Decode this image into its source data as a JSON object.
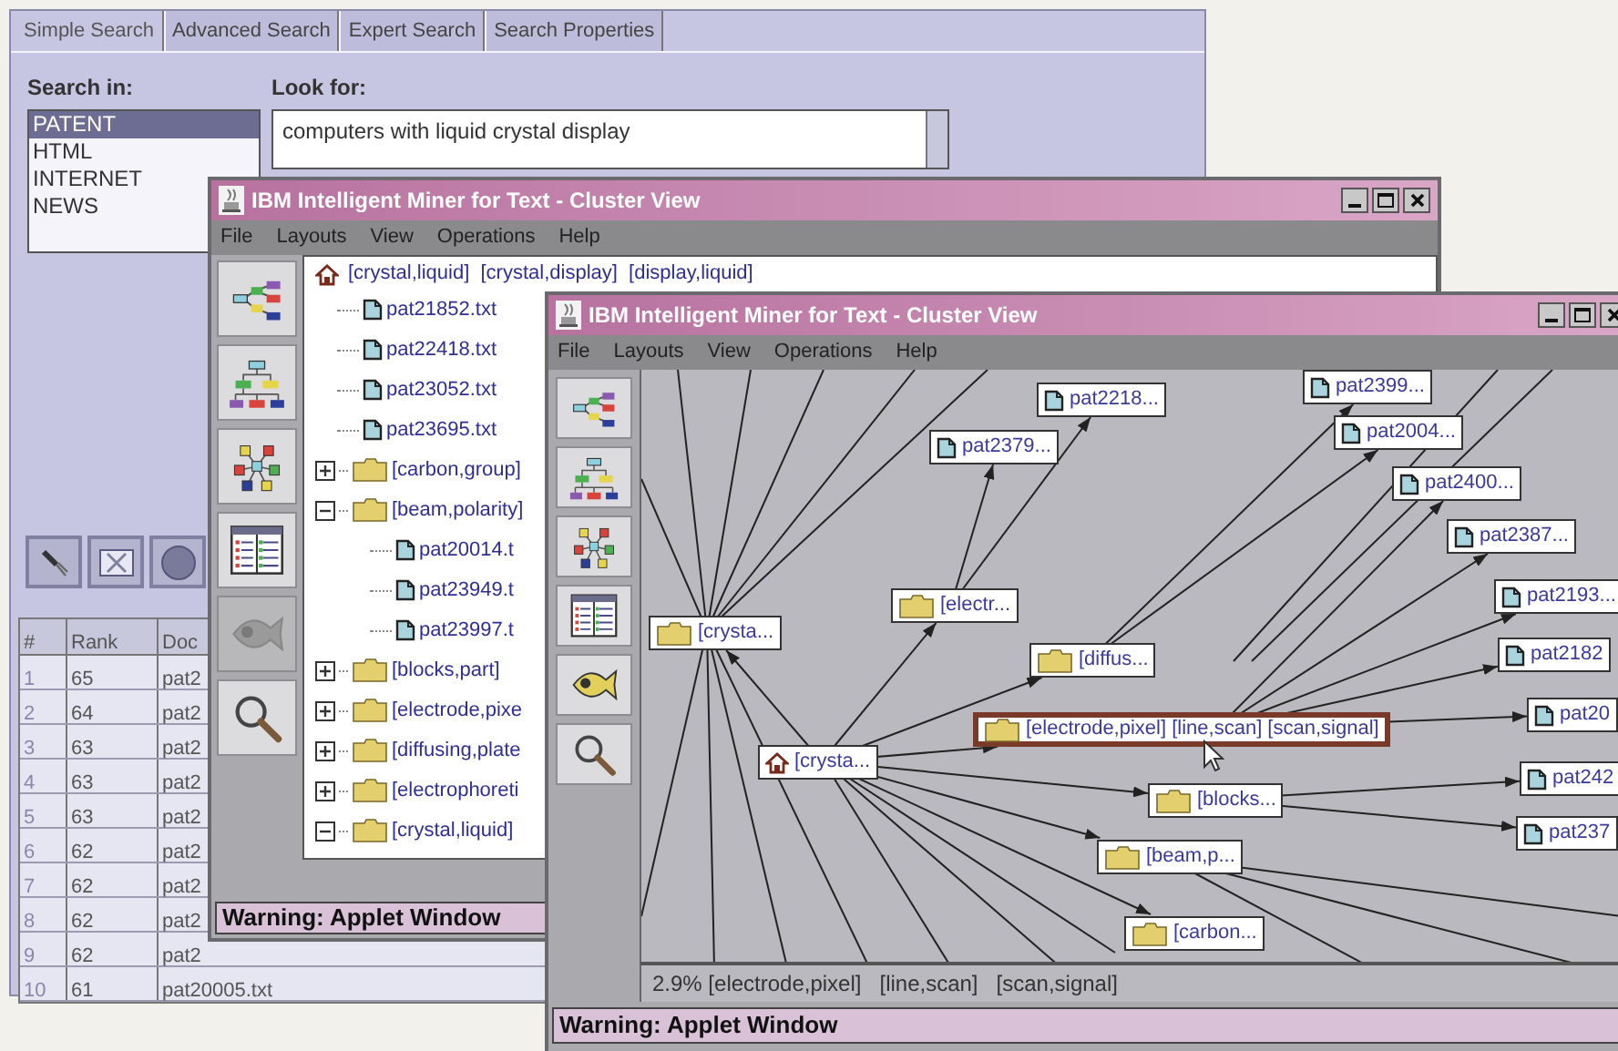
{
  "search_window": {
    "tabs": [
      {
        "label": "Simple Search",
        "selected": true
      },
      {
        "label": "Advanced Search",
        "selected": false
      },
      {
        "label": "Expert Search",
        "selected": false
      },
      {
        "label": "Search Properties",
        "selected": false
      }
    ],
    "search_in_label": "Search in:",
    "sources": [
      {
        "label": "PATENT",
        "selected": true
      },
      {
        "label": "HTML",
        "selected": false
      },
      {
        "label": "INTERNET",
        "selected": false
      },
      {
        "label": "NEWS",
        "selected": false
      }
    ],
    "look_for_label": "Look for:",
    "query": "computers with liquid crystal display",
    "tools": [
      {
        "kind": "wand"
      },
      {
        "kind": "clear"
      },
      {
        "kind": "stop"
      }
    ],
    "results": {
      "columns": [
        "#",
        "Rank",
        "Doc"
      ],
      "rows": [
        [
          "1",
          "65",
          "pat2"
        ],
        [
          "2",
          "64",
          "pat2"
        ],
        [
          "3",
          "63",
          "pat2"
        ],
        [
          "4",
          "63",
          "pat2"
        ],
        [
          "5",
          "63",
          "pat2"
        ],
        [
          "6",
          "62",
          "pat2"
        ],
        [
          "7",
          "62",
          "pat2"
        ],
        [
          "8",
          "62",
          "pat2"
        ],
        [
          "9",
          "62",
          "pat2"
        ],
        [
          "10",
          "61",
          "pat20005.txt"
        ]
      ]
    }
  },
  "tree_window": {
    "title": "IBM Intelligent Miner for Text - Cluster View",
    "menu": [
      "File",
      "Layouts",
      "View",
      "Operations",
      "Help"
    ],
    "toolbar": [
      {
        "kind": "cluster",
        "disabled": false
      },
      {
        "kind": "tree",
        "disabled": false
      },
      {
        "kind": "network",
        "disabled": false
      },
      {
        "kind": "table",
        "disabled": false
      },
      {
        "kind": "fish",
        "disabled": true
      },
      {
        "kind": "search",
        "disabled": false
      }
    ],
    "tree": {
      "label": "[crystal,liquid]  [crystal,display]  [display,liquid]",
      "children": [
        {
          "kind": "file",
          "label": "pat21852.txt"
        },
        {
          "kind": "file",
          "label": "pat22418.txt"
        },
        {
          "kind": "file",
          "label": "pat23052.txt"
        },
        {
          "kind": "file",
          "label": "pat23695.txt"
        },
        {
          "kind": "folder",
          "label": "[carbon,group]",
          "expanded": false
        },
        {
          "kind": "folder",
          "label": "[beam,polarity]",
          "expanded": true,
          "children": [
            {
              "kind": "file",
              "label": "pat20014.t"
            },
            {
              "kind": "file",
              "label": "pat23949.t"
            },
            {
              "kind": "file",
              "label": "pat23997.t"
            }
          ]
        },
        {
          "kind": "folder",
          "label": "[blocks,part]",
          "expanded": false
        },
        {
          "kind": "folder",
          "label": "[electrode,pixe",
          "expanded": false
        },
        {
          "kind": "folder",
          "label": "[diffusing,plate",
          "expanded": false
        },
        {
          "kind": "folder",
          "label": "[electrophoreti",
          "expanded": false
        },
        {
          "kind": "folder",
          "label": "[crystal,liquid]",
          "expanded": true
        }
      ]
    },
    "warning": "Warning: Applet Window"
  },
  "graph_window": {
    "title": "IBM Intelligent Miner for Text - Cluster View",
    "menu": [
      "File",
      "Layouts",
      "View",
      "Operations",
      "Help"
    ],
    "toolbar": [
      {
        "kind": "cluster",
        "disabled": false
      },
      {
        "kind": "tree",
        "disabled": false
      },
      {
        "kind": "network",
        "disabled": false
      },
      {
        "kind": "table",
        "disabled": false
      },
      {
        "kind": "fish",
        "disabled": false
      },
      {
        "kind": "search",
        "disabled": false
      }
    ],
    "nodes": [
      {
        "kind": "file",
        "label": "pat2218...",
        "selected": false
      },
      {
        "kind": "file",
        "label": "pat2379...",
        "selected": false
      },
      {
        "kind": "file",
        "label": "pat2399...",
        "selected": false
      },
      {
        "kind": "file",
        "label": "pat2004...",
        "selected": false
      },
      {
        "kind": "file",
        "label": "pat2400...",
        "selected": false
      },
      {
        "kind": "file",
        "label": "pat2387...",
        "selected": false
      },
      {
        "kind": "file",
        "label": "pat2193...",
        "selected": false
      },
      {
        "kind": "file",
        "label": "pat2182",
        "selected": false
      },
      {
        "kind": "folder",
        "label": "[electr...",
        "selected": false
      },
      {
        "kind": "folder",
        "label": "[crysta...",
        "selected": false
      },
      {
        "kind": "folder",
        "label": "[diffus...",
        "selected": false
      },
      {
        "kind": "folder",
        "label": "[electrode,pixel]   [line,scan]   [scan,signal]",
        "selected": true
      },
      {
        "kind": "root",
        "label": "[crysta...",
        "selected": false
      },
      {
        "kind": "file",
        "label": "pat20",
        "selected": false
      },
      {
        "kind": "folder",
        "label": "[blocks...",
        "selected": false
      },
      {
        "kind": "file",
        "label": "pat242",
        "selected": false
      },
      {
        "kind": "file",
        "label": "pat237",
        "selected": false
      },
      {
        "kind": "folder",
        "label": "[beam,p...",
        "selected": false
      },
      {
        "kind": "folder",
        "label": "[carbon...",
        "selected": false
      }
    ],
    "status_text": "2.9% [electrode,pixel]   [line,scan]   [scan,signal]",
    "warning": "Warning: Applet Window"
  }
}
